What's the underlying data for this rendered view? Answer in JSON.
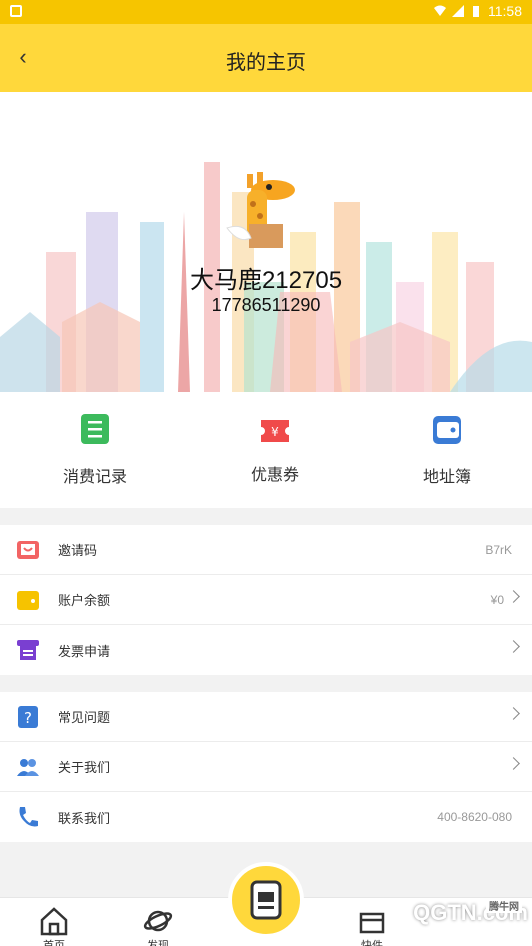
{
  "status_bar": {
    "time": "11:58"
  },
  "header": {
    "title": "我的主页"
  },
  "profile": {
    "username": "大马鹿212705",
    "phone": "17786511290"
  },
  "quick_actions": [
    {
      "label": "消费记录",
      "icon": "records-icon",
      "color": "#3cba5c"
    },
    {
      "label": "优惠券",
      "icon": "coupon-icon",
      "color": "#f04a4a"
    },
    {
      "label": "地址簿",
      "icon": "wallet-icon",
      "color": "#3a7bd5"
    }
  ],
  "menu_group_1": [
    {
      "label": "邀请码",
      "value": "B7rK",
      "icon": "invite-icon"
    },
    {
      "label": "账户余额",
      "value": "¥0",
      "icon": "balance-icon"
    },
    {
      "label": "发票申请",
      "value": "",
      "icon": "invoice-icon"
    }
  ],
  "menu_group_2": [
    {
      "label": "常见问题",
      "value": "",
      "icon": "faq-icon"
    },
    {
      "label": "关于我们",
      "value": "",
      "icon": "about-icon"
    },
    {
      "label": "联系我们",
      "value": "400-8620-080",
      "icon": "phone-icon"
    }
  ],
  "bottom_nav": [
    {
      "label": "首页",
      "icon": "home-icon"
    },
    {
      "label": "发现",
      "icon": "planet-icon"
    },
    {
      "label": "",
      "icon": "scan-icon"
    },
    {
      "label": "快件",
      "icon": "parcel-icon"
    }
  ],
  "watermark": {
    "text": "QGTN.com",
    "small": "腾牛网"
  },
  "colors": {
    "accent": "#ffd83b",
    "status_bar": "#f6c500"
  }
}
